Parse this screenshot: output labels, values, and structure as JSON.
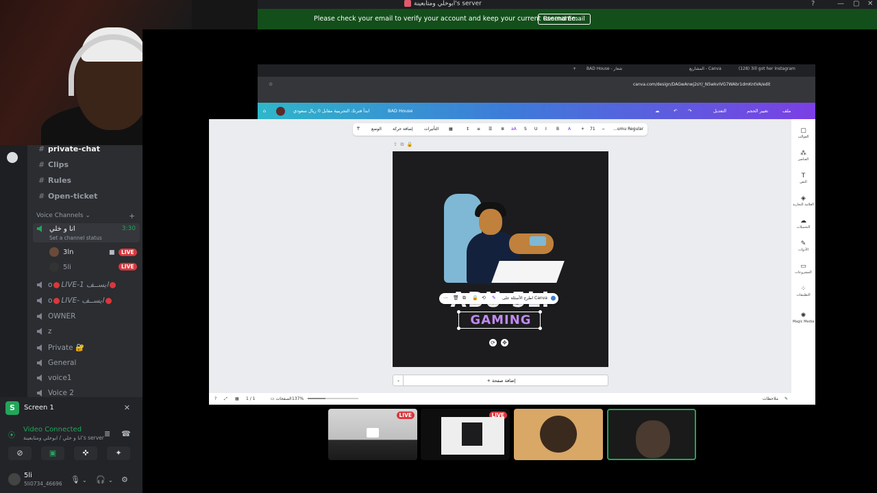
{
  "window": {
    "title": "ابوخلي ومتابعينة's server",
    "minimize": "—",
    "maximize": "▢",
    "close": "✕",
    "help": "?"
  },
  "notice": {
    "message": "Please check your email to verify your account and keep your current username.",
    "button": "Resend Email"
  },
  "channels": {
    "text": [
      {
        "name": "private-chat",
        "active": true
      },
      {
        "name": "Clips"
      },
      {
        "name": "Rules"
      },
      {
        "name": "Open-ticket"
      }
    ],
    "voice_header": "Voice Channels",
    "current_voice": {
      "name": "انا و خلي",
      "timer": "3:30",
      "status": "Set a channel status",
      "users": [
        {
          "name": "3ln",
          "live": "LIVE"
        },
        {
          "name": "5li",
          "live": "LIVE"
        }
      ]
    },
    "voice": [
      {
        "prefix": "o",
        "name": "LIVE-1 ﺍﻳﺴــﻒ"
      },
      {
        "prefix": "o",
        "name": "LIVE- ﺍﻳﺴــﻒ"
      },
      {
        "name": "OWNER"
      },
      {
        "name": "z"
      },
      {
        "name": "Private 🔐"
      },
      {
        "name": "General"
      },
      {
        "name": "voice1"
      },
      {
        "name": "Voice 2"
      }
    ]
  },
  "panel": {
    "screen_avatar": "S",
    "screen_name": "Screen 1",
    "status": "Video Connected",
    "sub": "انا و خلي / ابوخلي ومتابعينة's server",
    "me_name": "5li",
    "me_tag": "5li0734_46696"
  },
  "browser": {
    "tabs": [
      "BAD House - شعار",
      "المشاريع - Canva",
      "(128) 3ill got her Instagram"
    ],
    "url": "canva.com/design/DAGwAnwj2sY/_N5wkvIVG7WAbr1dmKntVA/edit"
  },
  "canva_bar": {
    "file": "ملف",
    "resize": "تغيير الحجم",
    "edit": "التعديل",
    "doc_name": "BAD House",
    "promo": "ابدأ فترتك التجريبية مقابل 0 ريال سعودي"
  },
  "toolbar": {
    "font": "...umu Regular",
    "effects": "التأثيرات",
    "animate": "إضافة حركة",
    "position": "الوضع"
  },
  "rail": [
    {
      "icon": "▢",
      "label": "القوالب"
    },
    {
      "icon": "⁂",
      "label": "العناصر"
    },
    {
      "icon": "T",
      "label": "النص"
    },
    {
      "icon": "◈",
      "label": "العلامة التجارية"
    },
    {
      "icon": "☁",
      "label": "التحميلات"
    },
    {
      "icon": "✎",
      "label": "الأدوات"
    },
    {
      "icon": "▭",
      "label": "المشروعات"
    },
    {
      "icon": "⁘",
      "label": "التطبيقات"
    },
    {
      "icon": "✺",
      "label": "Magic Media"
    }
  ],
  "design": {
    "title_text": "ABU 5LI",
    "subtitle_text": "GAMING",
    "ctx_text": "اطرح الأسئلة على Canva"
  },
  "editor": {
    "add_page": "+ إضافة صفحة",
    "pages_label": "الصفحات",
    "page_count": "1 / 1",
    "zoom": "137%",
    "zoom_fraction": 0.35,
    "notes": "ملاحظات"
  },
  "thumbs": [
    {
      "live": "LIVE"
    },
    {
      "live": "LIVE"
    },
    {},
    {}
  ],
  "colors": {
    "green": "#23a55a",
    "live_red": "#da373c",
    "notice_bg": "#134f1a"
  }
}
